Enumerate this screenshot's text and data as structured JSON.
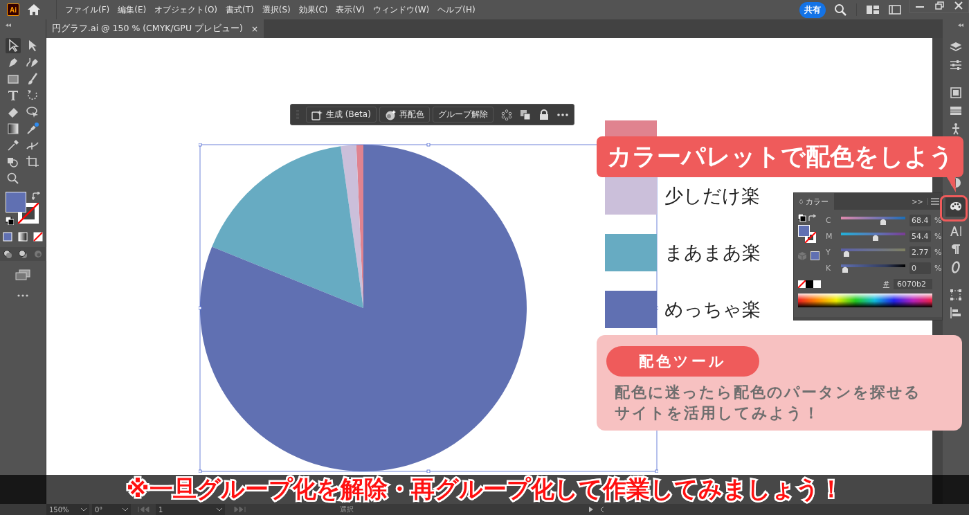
{
  "menu_bar": {
    "app_badge": "Ai",
    "menus": [
      "ファイル(F)",
      "編集(E)",
      "オブジェクト(O)",
      "書式(T)",
      "選択(S)",
      "効果(C)",
      "表示(V)",
      "ウィンドウ(W)",
      "ヘルプ(H)"
    ],
    "share_button": "共有"
  },
  "document_tab": {
    "title": "円グラフ.ai @ 150 % (CMYK/GPU プレビュー)",
    "close": "×"
  },
  "context_toolbar": {
    "buttons": [
      "生成 (Beta)",
      "再配色",
      "グループ解除"
    ]
  },
  "legend": [
    {
      "color": "#e0838f"
    },
    {
      "label": "少しだけ楽",
      "color": "#cbbfda"
    },
    {
      "label": "まあまあ楽",
      "color": "#67abc2"
    },
    {
      "label": "めっちゃ楽",
      "color": "#6070b2"
    }
  ],
  "color_panel": {
    "tab": "カラー",
    "expand": ">>",
    "channels": [
      {
        "name": "C",
        "value": "68.4",
        "unit": "%",
        "level": 0.68
      },
      {
        "name": "M",
        "value": "54.4",
        "unit": "%",
        "level": 0.54
      },
      {
        "name": "Y",
        "value": "2.77",
        "unit": "%",
        "level": 0.03
      },
      {
        "name": "K",
        "value": "0",
        "unit": "%",
        "level": 0
      }
    ],
    "hash": "#",
    "hex": "6070b2"
  },
  "callout": {
    "text": "カラーパレットで配色をしよう"
  },
  "tip_card": {
    "badge": "配色ツール",
    "lines": [
      "配色に迷ったら配色のパータンを探せる",
      "サイトを活用してみよう！"
    ]
  },
  "banner": "※一旦グループ化を解除・再グループ化して作業してみましょう！",
  "status_bar": {
    "zoom": "150%",
    "rotation": "0°",
    "artboard": "1",
    "tool": "選択"
  }
}
